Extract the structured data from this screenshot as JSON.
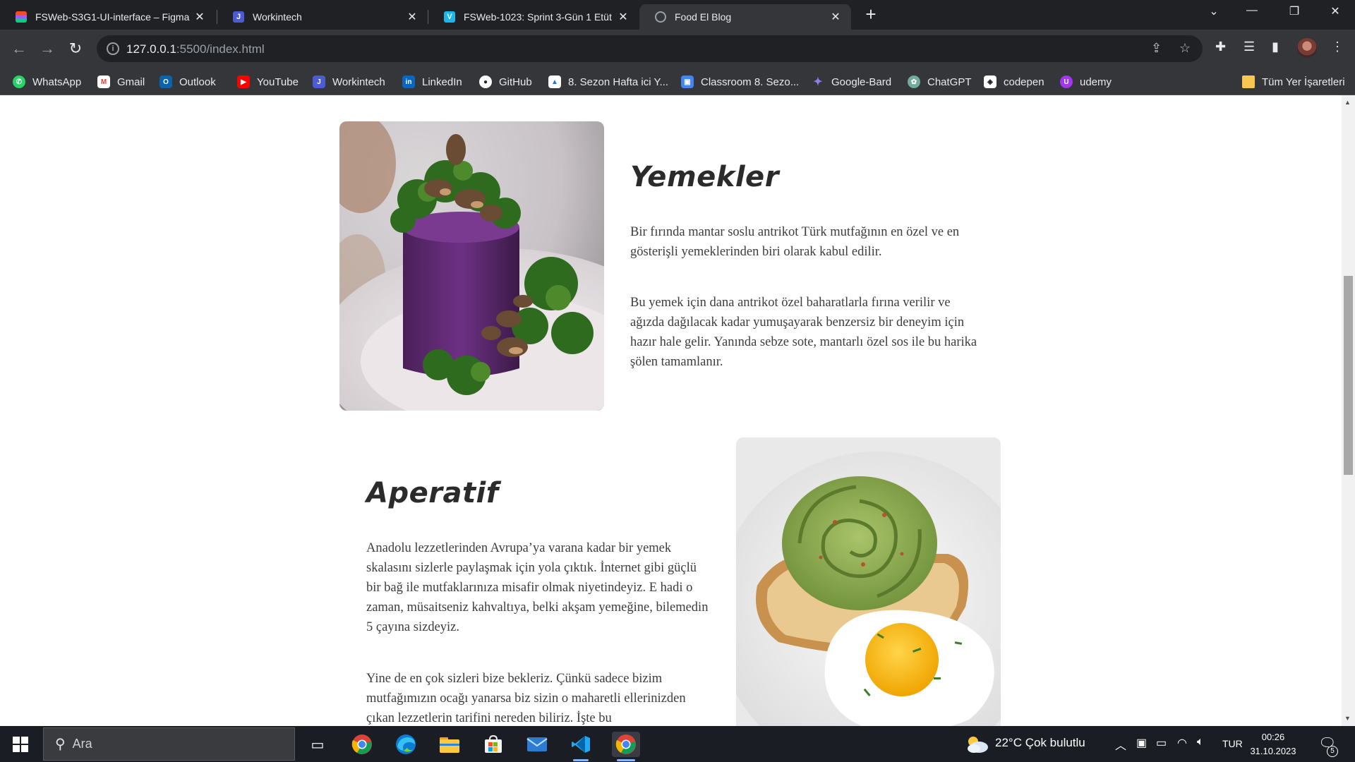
{
  "browser": {
    "tabs": [
      {
        "title": "FSWeb-S3G1-UI-interface – Figma",
        "icon": "figma-icon",
        "color": "#f24e1e"
      },
      {
        "title": "Workintech",
        "icon": "workintech-icon",
        "color": "#4c5bd4"
      },
      {
        "title": "FSWeb-1023: Sprint 3-Gün 1 Etüt",
        "icon": "vimeo-icon",
        "color": "#1ab7ea"
      },
      {
        "title": "Food El Blog",
        "icon": "globe-icon",
        "color": "#9aa0a6"
      }
    ],
    "url_host": "127.0.0.1",
    "url_path": ":5500/index.html"
  },
  "bookmarks": [
    {
      "label": "WhatsApp",
      "icon": "whatsapp-icon",
      "color": "#25d366"
    },
    {
      "label": "Gmail",
      "icon": "gmail-icon",
      "color": "#ea4335"
    },
    {
      "label": "Outlook",
      "icon": "outlook-icon",
      "color": "#0a64ad"
    },
    {
      "label": "YouTube",
      "icon": "youtube-icon",
      "color": "#ff0000"
    },
    {
      "label": "Workintech",
      "icon": "workintech-icon",
      "color": "#4c5bd4"
    },
    {
      "label": "LinkedIn",
      "icon": "linkedin-icon",
      "color": "#0a66c2"
    },
    {
      "label": "GitHub",
      "icon": "github-icon",
      "color": "#ffffff"
    },
    {
      "label": "8. Sezon Hafta ici Y...",
      "icon": "document-icon",
      "color": "#ffffff"
    },
    {
      "label": "Classroom 8. Sezo...",
      "icon": "classroom-icon",
      "color": "#4285f4"
    },
    {
      "label": "Google-Bard",
      "icon": "bard-icon",
      "color": "#8e7cf0"
    },
    {
      "label": "ChatGPT",
      "icon": "chatgpt-icon",
      "color": "#74aa9c"
    },
    {
      "label": "codepen",
      "icon": "codepen-icon",
      "color": "#ffffff"
    },
    {
      "label": "udemy",
      "icon": "udemy-icon",
      "color": "#a435f0"
    }
  ],
  "all_bookmarks": "Tüm Yer İşaretleri",
  "page": {
    "sections": [
      {
        "heading": "Yemekler",
        "paragraphs": [
          "Bir fırında mantar soslu antrikot Türk mutfağının en özel ve en gösterişli yemeklerinden biri olarak kabul edilir.",
          "Bu yemek için dana antrikot özel baharatlarla fırına verilir ve ağızda dağılacak kadar yumuşayarak benzersiz bir deneyim için hazır hale gelir. Yanında sebze sote, mantarlı özel sos ile bu harika şölen tamamlanır."
        ]
      },
      {
        "heading": "Aperatif",
        "paragraphs": [
          "Anadolu lezzetlerinden Avrupa’ya varana kadar bir yemek skalasını sizlerle paylaşmak için yola çıktık. İnternet gibi güçlü bir bağ ile mutfaklarınıza misafir olmak niyetindeyiz. E hadi o zaman, müsaitseniz kahvaltıya, belki akşam yemeğine, bilemedin 5 çayına sizdeyiz.",
          "Yine de en çok sizleri bize bekleriz. Çünkü sadece bizim mutfağımızın ocağı yanarsa biz sizin o maharetli ellerinizden çıkan lezzetlerin tarifini nereden biliriz. İşte bu"
        ]
      }
    ]
  },
  "taskbar": {
    "search_placeholder": "Ara",
    "weather": "22°C  Çok bulutlu",
    "language": "TUR",
    "time": "00:26",
    "date": "31.10.2023",
    "notifications": "5"
  }
}
